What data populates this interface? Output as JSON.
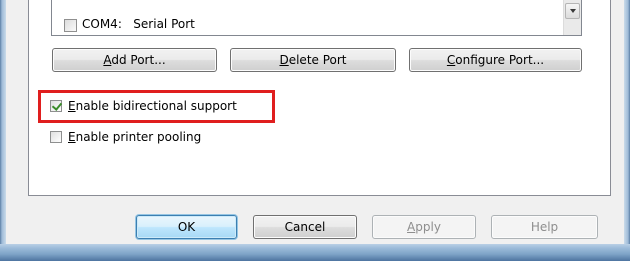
{
  "port_list": {
    "row": {
      "label": "COM4:   Serial Port",
      "checked": false
    },
    "scroll_down_icon": "chevron-down-icon"
  },
  "port_buttons": {
    "add_label_u": "A",
    "add_label_rest": "dd Port...",
    "delete_label_u": "D",
    "delete_label_rest": "elete Port",
    "configure_label_u": "C",
    "configure_label_rest": "onfigure Port..."
  },
  "options": {
    "bidirectional": {
      "label_u": "E",
      "label_rest": "nable bidirectional support",
      "checked": true,
      "highlighted": true,
      "highlight_color": "#e01e1e"
    },
    "pooling": {
      "label_u": "E",
      "label_rest": "nable printer pooling",
      "checked": false
    }
  },
  "dialog_buttons": {
    "ok_label": "OK",
    "cancel_label": "Cancel",
    "apply_label_u": "A",
    "apply_label_rest": "pply",
    "help_label": "Help"
  }
}
